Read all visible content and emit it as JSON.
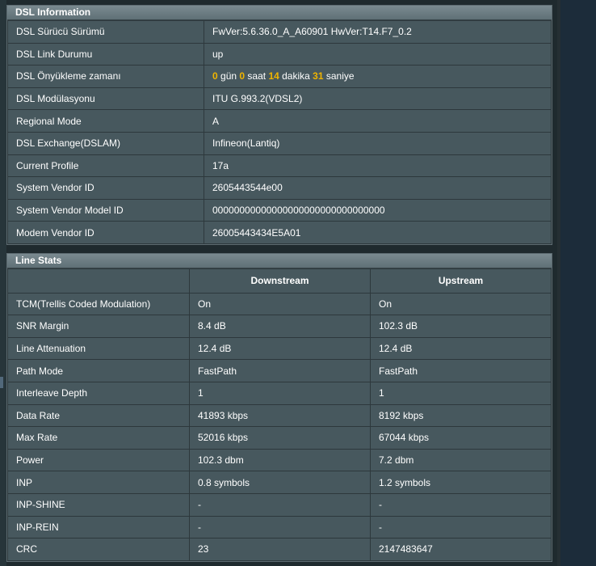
{
  "dsl_info": {
    "title": "DSL Information",
    "driver": {
      "label": "DSL Sürücü Sürümü",
      "value": "FwVer:5.6.36.0_A_A60901 HwVer:T14.F7_0.2"
    },
    "link": {
      "label": "DSL Link Durumu",
      "value": "up"
    },
    "uptime": {
      "label": "DSL Önyükleme zamanı",
      "days": "0",
      "days_unit": " gün ",
      "hours": "0",
      "hours_unit": " saat ",
      "minutes": "14",
      "minutes_unit": " dakika ",
      "seconds": "31",
      "seconds_unit": " saniye"
    },
    "modulation": {
      "label": "DSL Modülasyonu",
      "value": "ITU G.993.2(VDSL2)"
    },
    "regional": {
      "label": "Regional Mode",
      "value": "A"
    },
    "dslam": {
      "label": "DSL Exchange(DSLAM)",
      "value": "Infineon(Lantiq)"
    },
    "profile": {
      "label": "Current Profile",
      "value": "17a"
    },
    "vendor_id": {
      "label": "System Vendor ID",
      "value": "2605443544e00"
    },
    "vendor_model": {
      "label": "System Vendor Model ID",
      "value": "00000000000000000000000000000000"
    },
    "modem_vendor": {
      "label": "Modem Vendor ID",
      "value": "26005443434E5A01"
    }
  },
  "line_stats": {
    "title": "Line Stats",
    "columns": [
      "",
      "Downstream",
      "Upstream"
    ],
    "rows": [
      {
        "label": "TCM(Trellis Coded Modulation)",
        "down": "On",
        "up": "On"
      },
      {
        "label": "SNR Margin",
        "down": "8.4 dB",
        "up": "102.3 dB"
      },
      {
        "label": "Line Attenuation",
        "down": "12.4 dB",
        "up": "12.4 dB"
      },
      {
        "label": "Path Mode",
        "down": "FastPath",
        "up": "FastPath"
      },
      {
        "label": "Interleave Depth",
        "down": "1",
        "up": "1"
      },
      {
        "label": "Data Rate",
        "down": "41893 kbps",
        "up": "8192 kbps"
      },
      {
        "label": "Max Rate",
        "down": "52016 kbps",
        "up": "67044 kbps"
      },
      {
        "label": "Power",
        "down": "102.3 dbm",
        "up": "7.2 dbm"
      },
      {
        "label": "INP",
        "down": "0.8 symbols",
        "up": "1.2 symbols"
      },
      {
        "label": "INP-SHINE",
        "down": "-",
        "up": "-"
      },
      {
        "label": "INP-REIN",
        "down": "-",
        "up": "-"
      },
      {
        "label": "CRC",
        "down": "23",
        "up": "2147483647"
      }
    ]
  },
  "colors": {
    "highlight": "#f0b400",
    "panel_bg": "#47585e",
    "header": "#6e7e84"
  }
}
